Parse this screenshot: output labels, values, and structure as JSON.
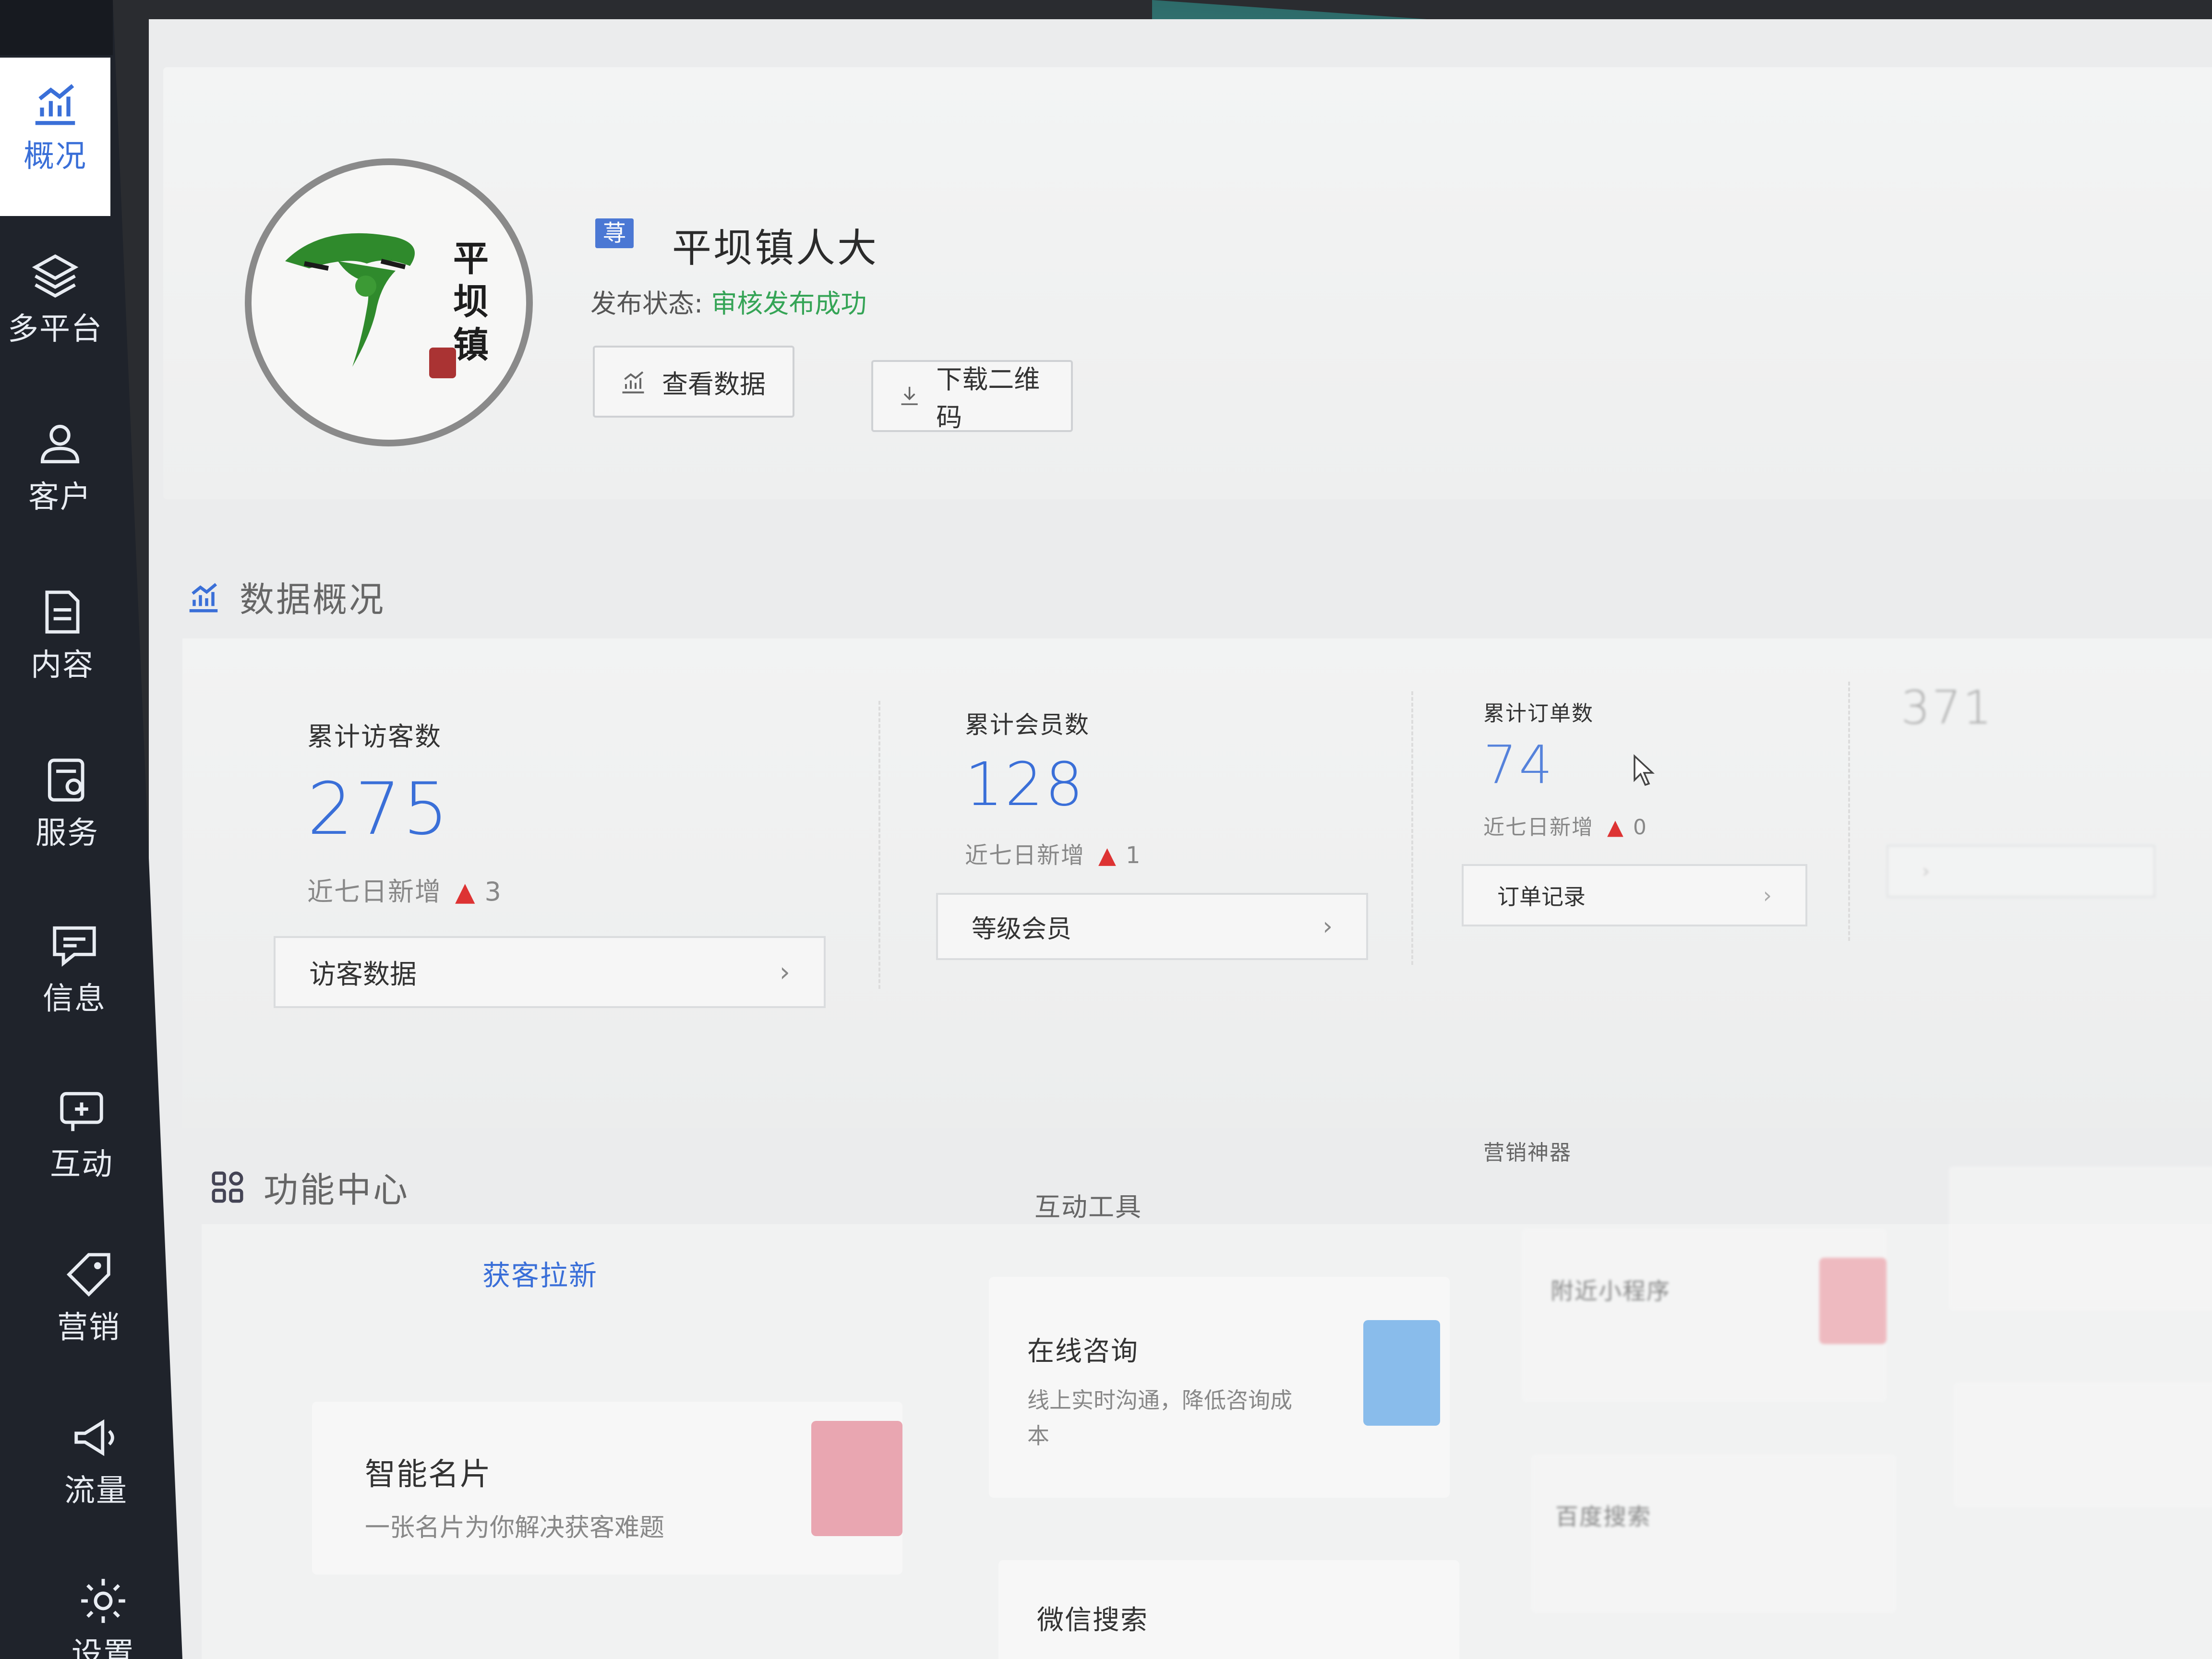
{
  "sidebar": {
    "items": [
      {
        "label": "概况",
        "icon": "chart-trend-icon"
      },
      {
        "label": "多平台",
        "icon": "layers-icon"
      },
      {
        "label": "客户",
        "icon": "user-icon"
      },
      {
        "label": "内容",
        "icon": "document-icon"
      },
      {
        "label": "服务",
        "icon": "service-icon"
      },
      {
        "label": "信息",
        "icon": "message-icon"
      },
      {
        "label": "互动",
        "icon": "interaction-icon"
      },
      {
        "label": "营销",
        "icon": "tag-icon"
      },
      {
        "label": "流量",
        "icon": "megaphone-icon"
      },
      {
        "label": "设置",
        "icon": "gear-icon"
      }
    ],
    "active_index": 0
  },
  "profile": {
    "badge": "荨",
    "name": "平坝镇人大",
    "status_label": "发布状态:",
    "status_value": "审核发布成功",
    "view_data_label": "查看数据",
    "download_qr_label": "下载二维码",
    "logo_text": "平坝镇",
    "status_color": "#35a456"
  },
  "overview": {
    "title": "数据概况",
    "stats": [
      {
        "label": "累计访客数",
        "value": "275",
        "delta_label": "近七日新增",
        "delta": "3",
        "link": "访客数据"
      },
      {
        "label": "累计会员数",
        "value": "128",
        "delta_label": "近七日新增",
        "delta": "1",
        "link": "等级会员"
      },
      {
        "label": "累计订单数",
        "value": "74",
        "delta_label": "近七日新增",
        "delta": "0",
        "link": "订单记录"
      },
      {
        "label": "",
        "value": "371",
        "delta_label": "",
        "delta": "",
        "link": ""
      }
    ]
  },
  "functions": {
    "title": "功能中心",
    "tabs": [
      "获客拉新",
      "互动工具",
      "营销神器"
    ],
    "active_tab": 0,
    "cards": [
      {
        "title": "智能名片",
        "subtitle": "一张名片为你解决获客难题"
      },
      {
        "title": "在线咨询",
        "subtitle": "线上实时沟通，降低咨询成本"
      },
      {
        "title": "附近小程序",
        "subtitle": ""
      },
      {
        "title": "微信搜索",
        "subtitle": ""
      },
      {
        "title": "百度搜索",
        "subtitle": ""
      }
    ]
  },
  "colors": {
    "accent": "#3a6fd8",
    "sidebar": "#1f232b",
    "delta_up": "#d33333"
  }
}
